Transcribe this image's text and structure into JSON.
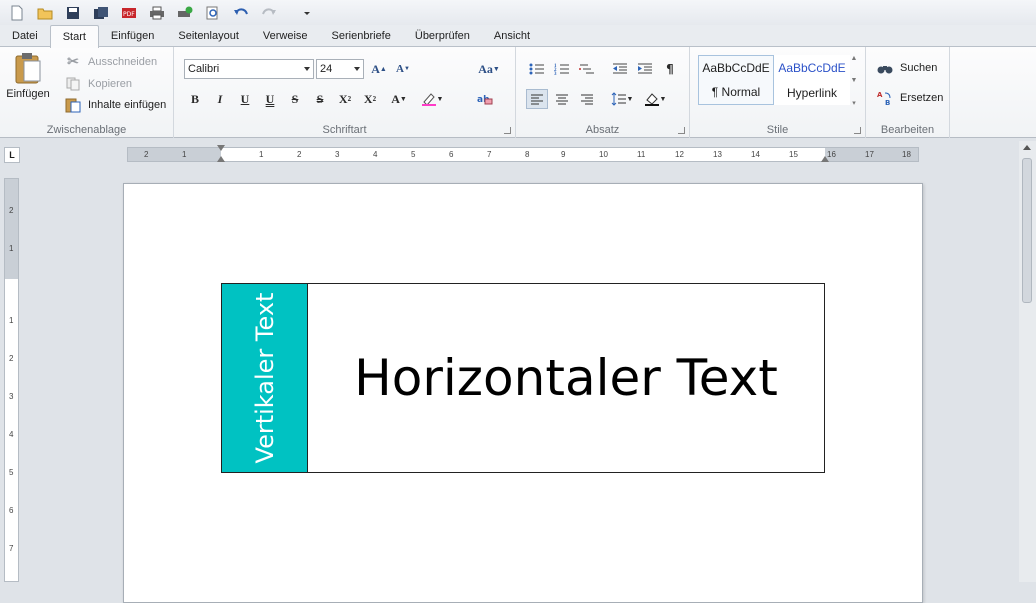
{
  "ribbon": {
    "tabs": [
      "Datei",
      "Start",
      "Einfügen",
      "Seitenlayout",
      "Verweise",
      "Serienbriefe",
      "Überprüfen",
      "Ansicht"
    ],
    "clipboard": {
      "paste_label": "Einfügen",
      "cut_label": "Ausschneiden",
      "copy_label": "Kopieren",
      "paste_special_label": "Inhalte einfügen",
      "group_label": "Zwischenablage"
    },
    "font": {
      "family": "Calibri",
      "size": "24",
      "case_label": "Aa",
      "group_label": "Schriftart"
    },
    "paragraph": {
      "group_label": "Absatz"
    },
    "styles": {
      "items": [
        {
          "preview": "AaBbCcDdE",
          "name": "¶ Normal"
        },
        {
          "preview": "AaBbCcDdE",
          "name": "Hyperlink"
        }
      ],
      "group_label": "Stile"
    },
    "editing": {
      "find_label": "Suchen",
      "replace_label": "Ersetzen",
      "group_label": "Bearbeiten"
    }
  },
  "ruler": {
    "h_labels": [
      "2",
      "1",
      "1",
      "2",
      "3",
      "4",
      "5",
      "6",
      "7",
      "8",
      "9",
      "10",
      "11",
      "12",
      "13",
      "14",
      "15",
      "16",
      "17",
      "18"
    ],
    "v_labels": [
      "2",
      "1",
      "1",
      "2",
      "3",
      "4",
      "5",
      "6",
      "7"
    ]
  },
  "document": {
    "vertical_text": "Vertikaler Text",
    "horizontal_text": "Horizontaler Text",
    "cell_color": "#00c2c2"
  }
}
